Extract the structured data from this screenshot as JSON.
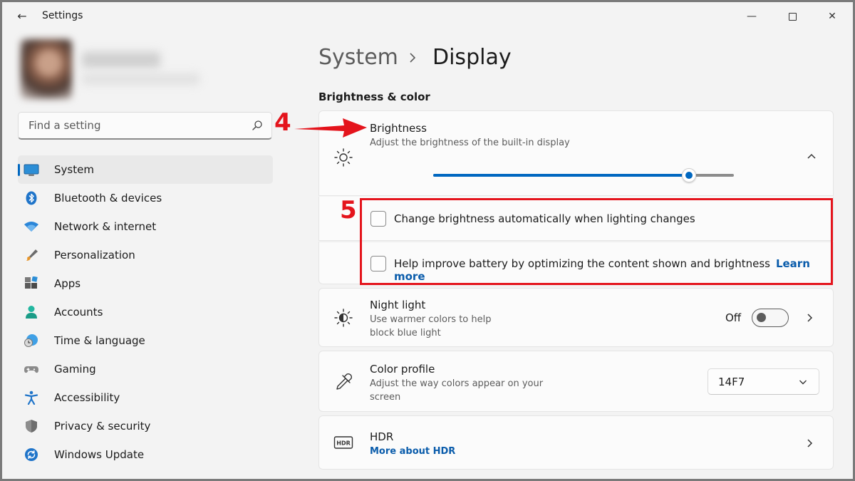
{
  "window": {
    "title": "Settings",
    "back_glyph": "←",
    "minimize_glyph": "—",
    "close_glyph": "✕"
  },
  "search": {
    "placeholder": "Find a setting"
  },
  "annotations": {
    "step4": "4",
    "step5": "5",
    "accent": "#e4141c"
  },
  "sidebar": {
    "items": [
      {
        "label": "System",
        "icon": "monitor-icon",
        "active": true
      },
      {
        "label": "Bluetooth & devices",
        "icon": "bluetooth-icon"
      },
      {
        "label": "Network & internet",
        "icon": "wifi-icon"
      },
      {
        "label": "Personalization",
        "icon": "brush-icon"
      },
      {
        "label": "Apps",
        "icon": "apps-icon"
      },
      {
        "label": "Accounts",
        "icon": "person-icon"
      },
      {
        "label": "Time & language",
        "icon": "clock-globe-icon"
      },
      {
        "label": "Gaming",
        "icon": "gamepad-icon"
      },
      {
        "label": "Accessibility",
        "icon": "accessibility-icon"
      },
      {
        "label": "Privacy & security",
        "icon": "shield-icon"
      },
      {
        "label": "Windows Update",
        "icon": "update-icon"
      }
    ]
  },
  "breadcrumb": {
    "parent": "System",
    "current": "Display"
  },
  "section": {
    "title": "Brightness & color"
  },
  "brightness": {
    "title": "Brightness",
    "subtitle": "Adjust the brightness of the built-in display",
    "level": 0.85,
    "auto_label": "Change brightness automatically when lighting changes",
    "battery_label": "Help improve battery by optimizing the content shown and brightness",
    "learn_more": "Learn more"
  },
  "night_light": {
    "title": "Night light",
    "subtitle_line1": "Use warmer colors to help",
    "subtitle_line2": "block blue light",
    "state": "Off"
  },
  "color_profile": {
    "title": "Color profile",
    "subtitle_line1": "Adjust the way colors appear on your",
    "subtitle_line2": "screen",
    "value": "14F7"
  },
  "hdr": {
    "title": "HDR",
    "link": "More about HDR",
    "icon_text": "HDR"
  },
  "colors": {
    "accent": "#0067c0",
    "link": "#0a5cab"
  }
}
